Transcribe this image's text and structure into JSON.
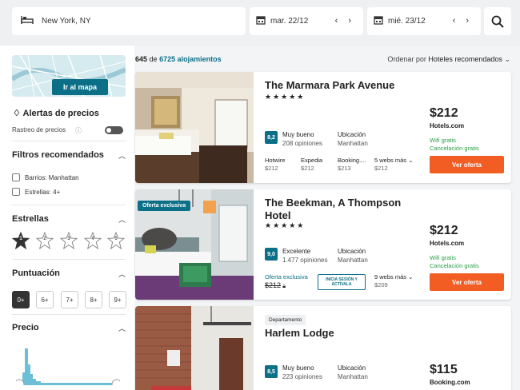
{
  "search": {
    "destination": "New York, NY",
    "checkin": "mar. 22/12",
    "checkout": "mié. 23/12",
    "date_arrows": "‹ ›"
  },
  "sidebar": {
    "map_button": "Ir al mapa",
    "alerts_title": "Alertas de precios",
    "price_tracking": "Rastreo de precios",
    "recommended_title": "Filtros recomendados",
    "recommended": [
      "Barrios: Manhattan",
      "Estrellas: 4+"
    ],
    "stars_title": "Estrellas",
    "star_options": [
      "1",
      "2",
      "3",
      "4",
      "5"
    ],
    "rating_title": "Puntuación",
    "rating_options": [
      "0+",
      "6+",
      "7+",
      "8+",
      "9+"
    ],
    "price_title": "Precio"
  },
  "results": {
    "count": "645",
    "of": "de",
    "total": "6725 alojamientos",
    "sort_label": "Ordenar por",
    "sort_value": "Hoteles recomendados"
  },
  "hotels": [
    {
      "name": "The Marmara Park Avenue",
      "stars": "★★★★★",
      "score": "8,2",
      "score_label": "Muy bueno",
      "reviews": "208 opiniones",
      "location_label": "Ubicación",
      "location": "Manhattan",
      "offers": [
        {
          "site": "Hotwire",
          "price": "$212"
        },
        {
          "site": "Expedia",
          "price": "$212"
        },
        {
          "site": "Booking....",
          "price": "$213"
        },
        {
          "site": "5 webs más",
          "price": "$212"
        }
      ],
      "price": "$212",
      "provider": "Hotels.com",
      "perk1": "Wifi gratis",
      "perk2": "Cancelación gratis",
      "cta": "Ver oferta"
    },
    {
      "badge": "Oferta exclusiva",
      "name": "The Beekman, A Thompson Hotel",
      "name_line1": "The Beekman, A Thompson",
      "name_line2": "Hotel",
      "stars": "★★★★★",
      "score": "9,0",
      "score_label": "Excelente",
      "reviews": "1.477 opiniones",
      "location_label": "Ubicación",
      "location": "Manhattan",
      "exclusive_label": "Oferta exclusiva",
      "exclusive_price": "$212",
      "signin": "INICIA SESIÓN Y ACTÍVALA",
      "more_sites": "9 webs más",
      "more_price": "$209",
      "price": "$212",
      "provider": "Hotels.com",
      "perk1": "Wifi gratis",
      "perk2": "Cancelación gratis",
      "cta": "Ver oferta"
    },
    {
      "tag": "Departamento",
      "name": "Harlem Lodge",
      "score": "8,5",
      "score_label": "Muy bueno",
      "reviews": "223 opiniones",
      "location_label": "Ubicación",
      "location": "Manhattan",
      "price": "$115",
      "provider": "Booking.com"
    }
  ],
  "colors": {
    "accent": "#0b6f88",
    "cta": "#f25d23",
    "perks": "#2a9d47"
  }
}
